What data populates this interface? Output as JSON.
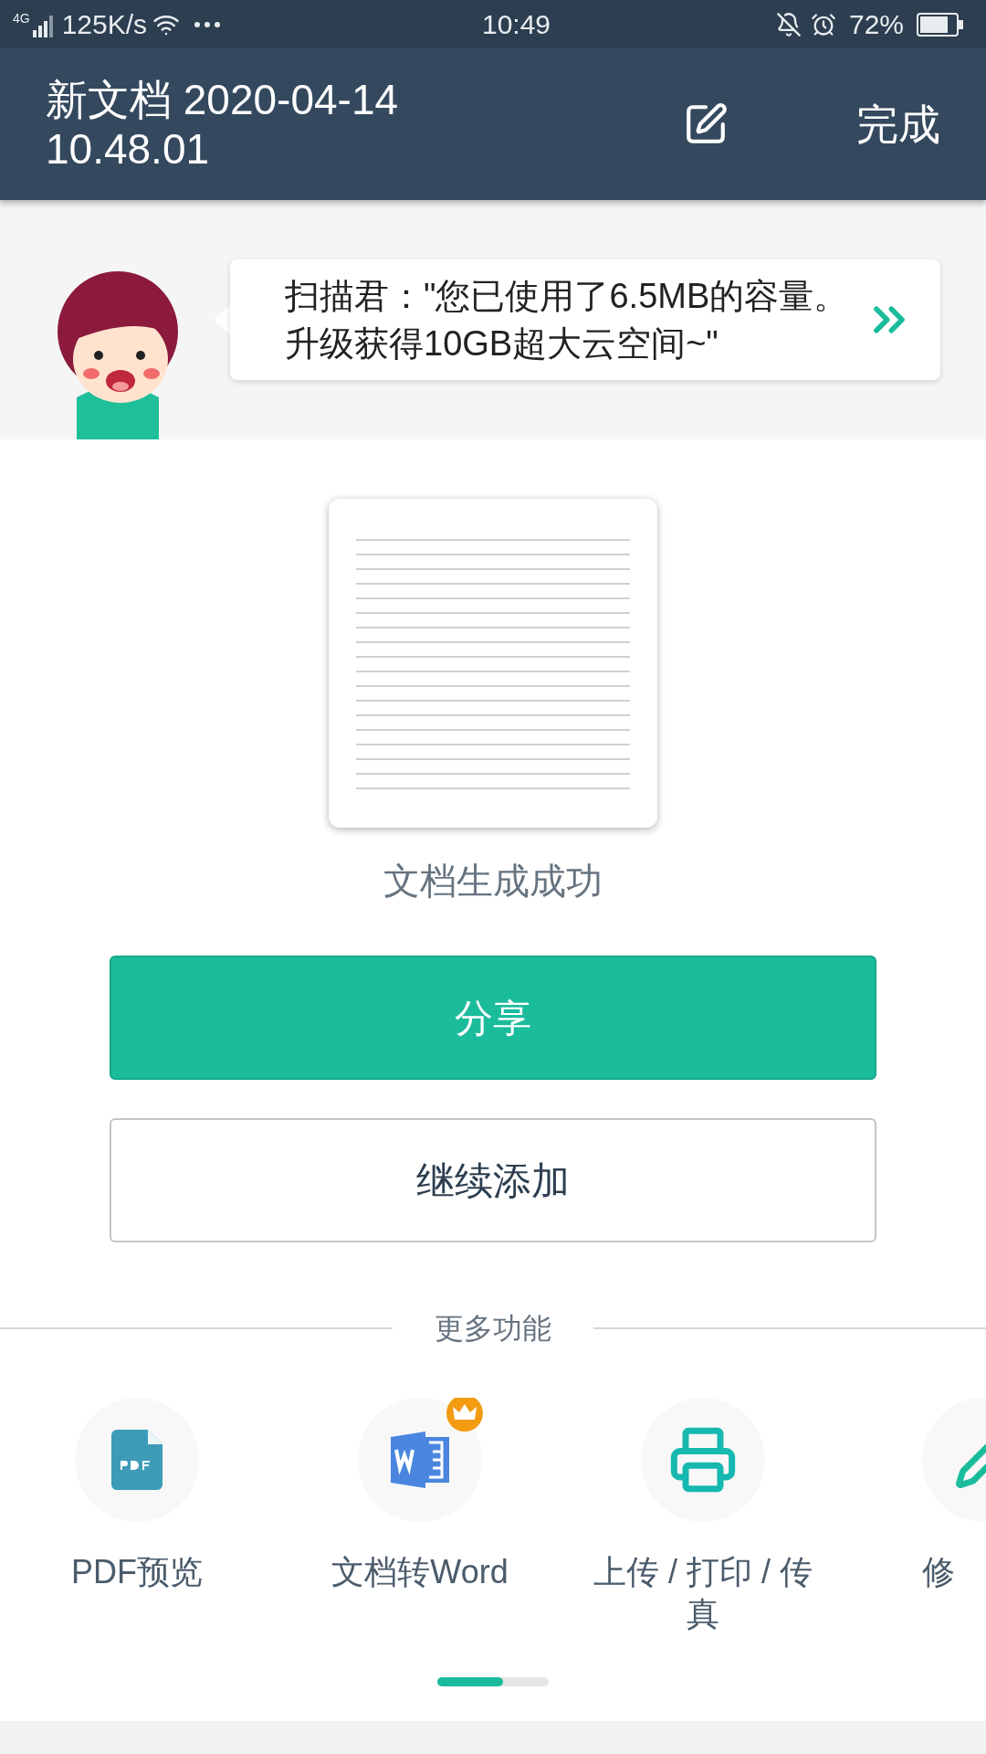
{
  "status_bar": {
    "network": "4G",
    "speed": "125K/s",
    "time": "10:49",
    "battery": "72%"
  },
  "header": {
    "title": "新文档 2020-04-14 10.48.01",
    "done": "完成"
  },
  "banner": {
    "speaker": "扫描君：",
    "message": "\"您已使用了6.5MB的容量。升级获得10GB超大云空间~\""
  },
  "document": {
    "caption": "文档生成成功"
  },
  "buttons": [
    {
      "label": "分享",
      "kind": "primary"
    },
    {
      "label": "继续添加",
      "kind": "outline"
    }
  ],
  "more": {
    "title": "更多功能",
    "items": [
      {
        "label": "PDF预览",
        "kind": "pdf",
        "premium": false
      },
      {
        "label": "文档转Word",
        "kind": "word",
        "premium": true
      },
      {
        "label": "上传 / 打印 / 传真",
        "kind": "print",
        "premium": false
      },
      {
        "label": "修",
        "kind": "edit"
      }
    ]
  }
}
